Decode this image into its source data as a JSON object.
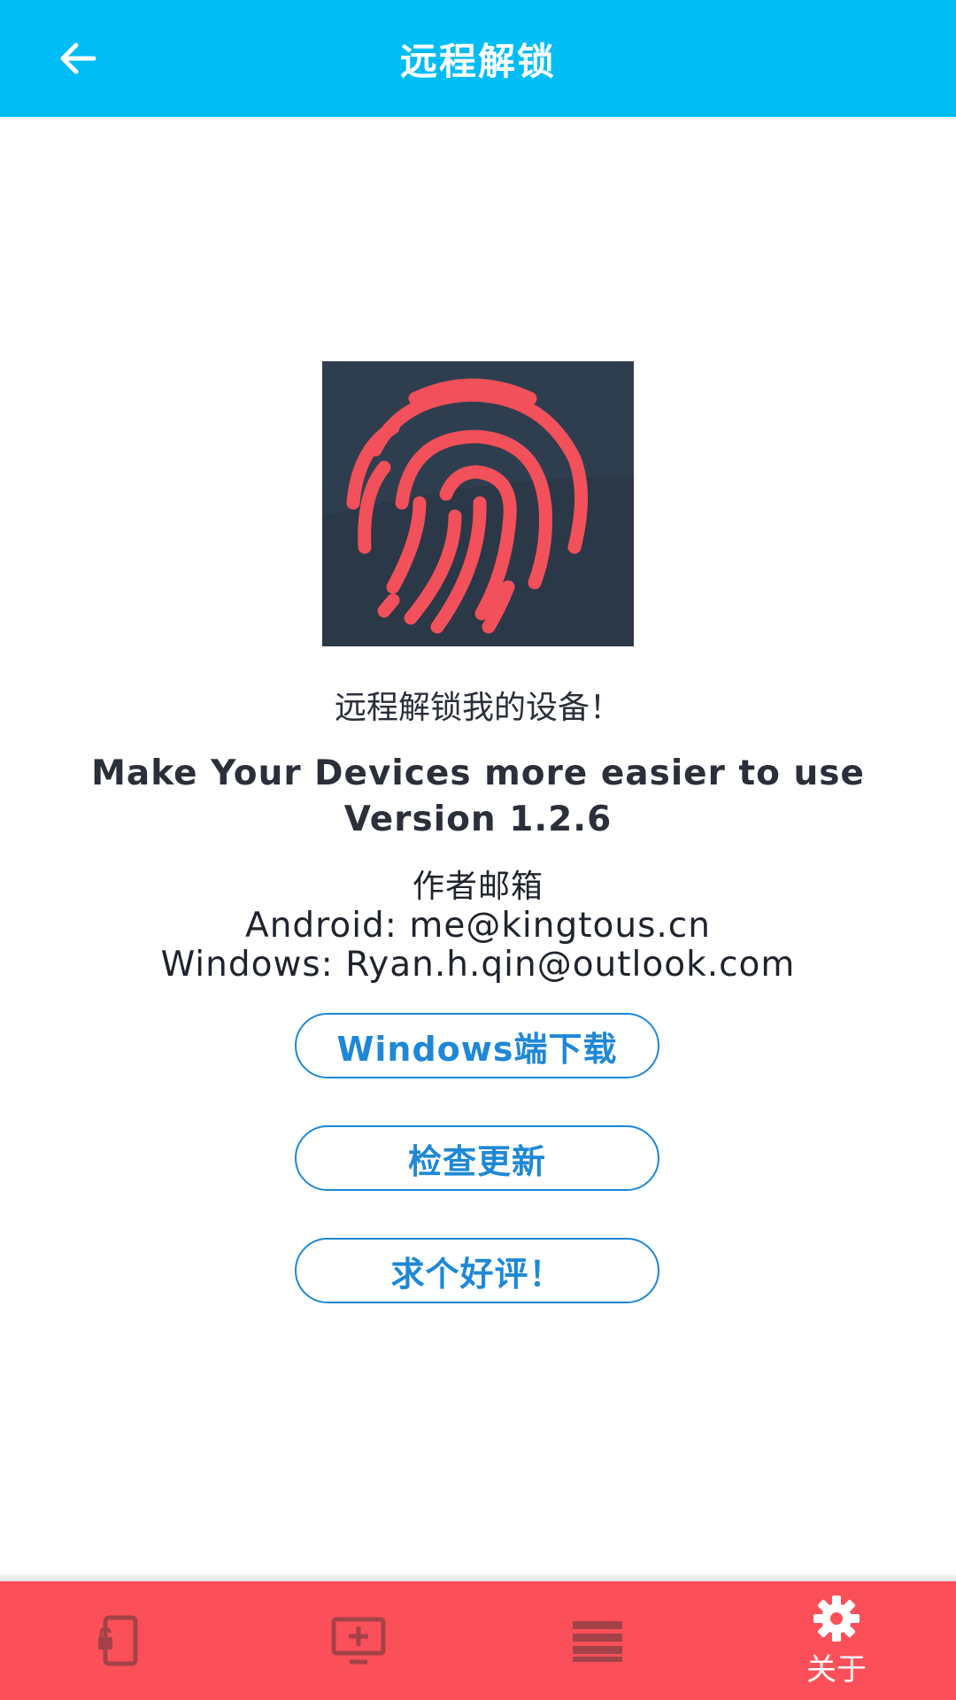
{
  "header": {
    "title": "远程解锁"
  },
  "about": {
    "tagline": "远程解锁我的设备！",
    "subtitle_line1": "Make Your Devices more easier to use",
    "subtitle_line2": "Version 1.2.6",
    "contact_heading": "作者邮箱",
    "contact_android": "Android: me@kingtous.cn",
    "contact_windows": "Windows: Ryan.h.qin@outlook.com"
  },
  "buttons": {
    "windows_download": "Windows端下载",
    "check_update": "检查更新",
    "rate": "求个好评！"
  },
  "bottom_nav": {
    "items": [
      {
        "icon": "phone-unlock-icon",
        "label": ""
      },
      {
        "icon": "monitor-add-icon",
        "label": ""
      },
      {
        "icon": "list-icon",
        "label": ""
      },
      {
        "icon": "gear-icon",
        "label": "关于"
      }
    ]
  },
  "colors": {
    "app_bar": "#00bdf6",
    "accent_blue": "#1e88d6",
    "bottom_nav": "#fb5059",
    "logo_bg": "#2f3e4f",
    "logo_fingerprint": "#f2505a"
  }
}
